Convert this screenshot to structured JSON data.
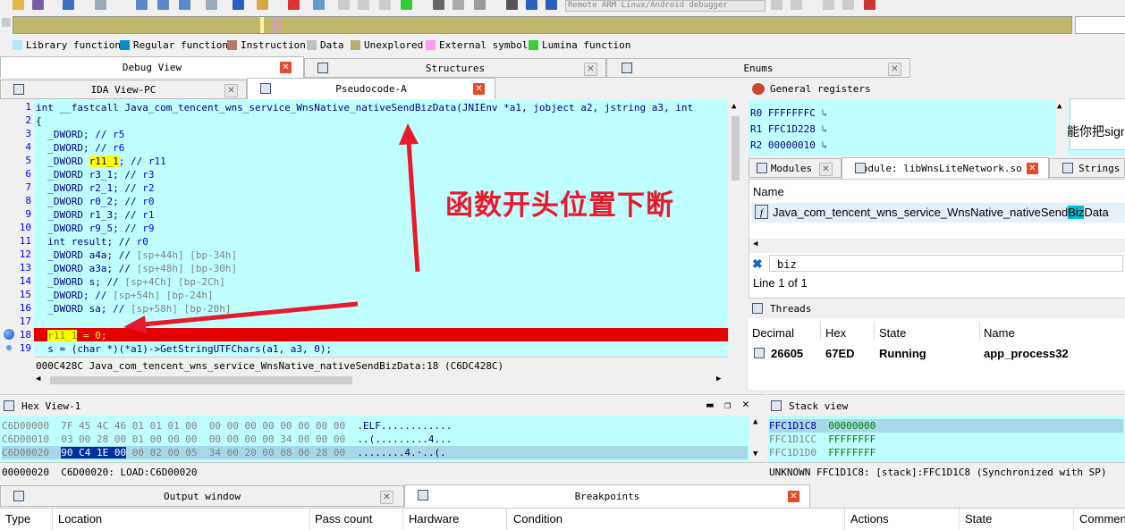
{
  "toolbar": {
    "debugger_select": "Remote ARM Linux/Android debugger"
  },
  "legend": [
    {
      "label": "Library function",
      "color": "#aee9ff"
    },
    {
      "label": "Regular function",
      "color": "#0a88d0"
    },
    {
      "label": "Instruction",
      "color": "#b3796b"
    },
    {
      "label": "Data",
      "color": "#c0c0c0"
    },
    {
      "label": "Unexplored",
      "color": "#b6ae72"
    },
    {
      "label": "External symbol",
      "color": "#ff9cf0"
    },
    {
      "label": "Lumina function",
      "color": "#3ccc3c"
    }
  ],
  "top_tabs": {
    "debug_view": "Debug View",
    "structures": "Structures",
    "enums": "Enums"
  },
  "code_tabs": {
    "ida_view": "IDA View-PC",
    "pseudocode": "Pseudocode-A"
  },
  "code": {
    "lines": [
      {
        "n": "1",
        "text": "int __fastcall Java_com_tencent_wns_service_WnsNative_nativeSendBizData(JNIEnv *a1, jobject a2, jstring a3, int"
      },
      {
        "n": "2",
        "text": "{"
      },
      {
        "n": "3",
        "pre": "  _DWORD; // ",
        "post": "r5"
      },
      {
        "n": "4",
        "pre": "  _DWORD; // ",
        "post": "r6"
      },
      {
        "n": "5",
        "pre": "  _DWORD ",
        "hl": "r11_1",
        "mid": "; // ",
        "post": "r11"
      },
      {
        "n": "6",
        "pre": "  _DWORD r3_1; // ",
        "post": "r3"
      },
      {
        "n": "7",
        "pre": "  _DWORD r2_1; // ",
        "post": "r2"
      },
      {
        "n": "8",
        "pre": "  _DWORD r0_2; // ",
        "post": "r0"
      },
      {
        "n": "9",
        "pre": "  _DWORD r1_3; // ",
        "post": "r1"
      },
      {
        "n": "10",
        "pre": "  _DWORD r9_5; // ",
        "post": "r9"
      },
      {
        "n": "11",
        "pre": "  int result; // ",
        "post": "r0"
      },
      {
        "n": "12",
        "pre": "  _DWORD a4a; // ",
        "post": "[sp+44h] [bp-34h]"
      },
      {
        "n": "13",
        "pre": "  _DWORD a3a; // ",
        "post": "[sp+48h] [bp-30h]"
      },
      {
        "n": "14",
        "pre": "  _DWORD s; // ",
        "post": "[sp+4Ch] [bp-2Ch]"
      },
      {
        "n": "15",
        "pre": "  _DWORD; // ",
        "post": "[sp+54h] [bp-24h]"
      },
      {
        "n": "16",
        "pre": "  _DWORD sa; // ",
        "post": "[sp+58h] [bp-20h]"
      },
      {
        "n": "17",
        "text": ""
      },
      {
        "n": "18",
        "text": "  r11_1 = 0;"
      },
      {
        "n": "19",
        "text": "  s = (char *)(*a1)->GetStringUTFChars(a1, a3, 0);"
      }
    ],
    "status": "000C428C Java_com_tencent_wns_service_WnsNative_nativeSendBizData:18 (C6DC428C)"
  },
  "annotation": "函数开头位置下断",
  "registers": {
    "title": "General registers",
    "rows": [
      {
        "name": "R0",
        "value": "FFFFFFFC"
      },
      {
        "name": "R1",
        "value": "FFC1D228"
      },
      {
        "name": "R2",
        "value": "00000010"
      }
    ]
  },
  "tooltip_text": "能你把sign",
  "modules": {
    "tabs": [
      "Modules",
      "Module: libWnsLiteNetwork.so",
      "Strings w"
    ],
    "name_header": "Name",
    "item_pre": "Java_com_tencent_wns_service_WnsNative_nativeSend",
    "item_hl": "Biz",
    "item_post": "Data",
    "search_value": "biz",
    "line_info": "Line 1 of 1"
  },
  "threads": {
    "title": "Threads",
    "headers": [
      "Decimal",
      "Hex",
      "State",
      "Name"
    ],
    "row": {
      "decimal": "26605",
      "hex": "67ED",
      "state": "Running",
      "name": "app_process32"
    }
  },
  "hex": {
    "title": "Hex View-1",
    "rows": [
      {
        "addr": "C6D00000",
        "bytes": "7F 45 4C 46 01 01 01 00  00 00 00 00 00 00 00 00",
        "ascii": ".ELF............"
      },
      {
        "addr": "C6D00010",
        "bytes": "03 00 28 00 01 00 00 00  00 00 00 00 34 00 00 00",
        "ascii": "..(.........4..."
      },
      {
        "addr": "C6D00020",
        "sel": "90 C4 1E 00",
        "bytes": " 00 02 00 05  34 00 20 00 08 00 28 00",
        "ascii": "........4.·..(."
      }
    ],
    "status": "00000020  C6D00020: LOAD:C6D00020"
  },
  "stack": {
    "title": "Stack view",
    "rows": [
      {
        "addr": "FFC1D1C8",
        "value": "00000000"
      },
      {
        "addr": "FFC1D1CC",
        "value": "FFFFFFFF"
      },
      {
        "addr": "FFC1D1D0",
        "value": "FFFFFFFF"
      }
    ],
    "status": "UNKNOWN FFC1D1C8: [stack]:FFC1D1C8 (Synchronized with SP)"
  },
  "bottom_tabs": {
    "output": "Output window",
    "breakpoints": "Breakpoints"
  },
  "bp_headers": [
    "Type",
    "Location",
    "Pass count",
    "Hardware",
    "Condition",
    "Actions",
    "State",
    "Commen"
  ],
  "colors": {
    "code_bg": "#c0ffff",
    "breakpoint_line": "#e30000",
    "annotation_red": "#e8192c"
  }
}
